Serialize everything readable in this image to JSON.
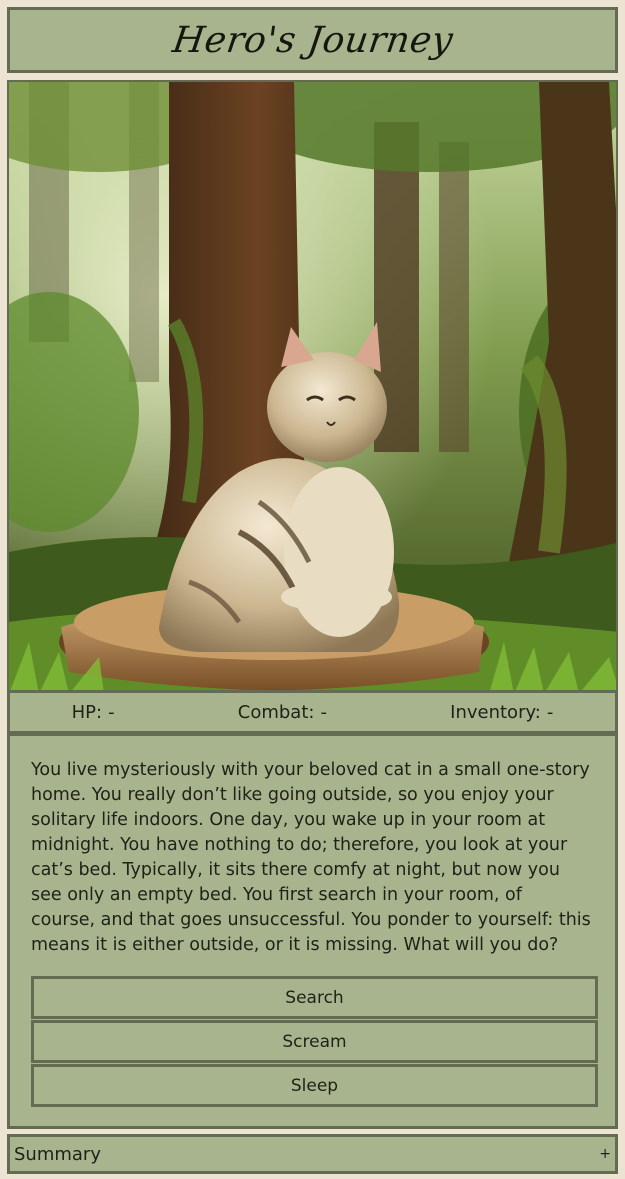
{
  "header": {
    "title": "Hero's Journey"
  },
  "scene": {
    "image_description_icon": "cat-in-forest-illustration"
  },
  "stats": {
    "hp_label": "HP:",
    "hp_value": "-",
    "combat_label": "Combat:",
    "combat_value": "-",
    "inventory_label": "Inventory:",
    "inventory_value": "-"
  },
  "story": {
    "text": "You live mysteriously with your beloved cat in a small one-story home. You really don’t like going outside, so you enjoy your solitary life indoors. One day, you wake up in your room at midnight. You have nothing to do; therefore, you look at your cat’s bed. Typically, it sits there comfy at night, but now you see only an empty bed. You first search in your room, of course, and that goes unsuccessful. You ponder to yourself: this means it is either outside, or it is missing. What will you do?"
  },
  "choices": [
    {
      "label": "Search"
    },
    {
      "label": "Scream"
    },
    {
      "label": "Sleep"
    }
  ],
  "summary": {
    "label": "Summary",
    "toggle": "+"
  },
  "colors": {
    "panel_bg": "#a7b48d",
    "border": "#636c53",
    "page_bg": "#ece3d3"
  }
}
